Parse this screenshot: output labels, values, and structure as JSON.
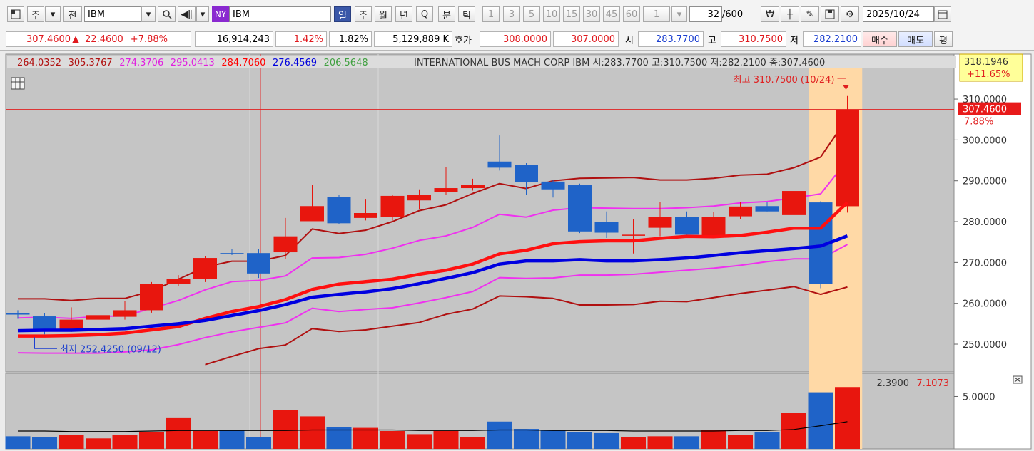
{
  "toolbar": {
    "period_week": "주",
    "prev_label": "전",
    "symbol": "IBM",
    "market_badge": "NY",
    "symbol_name": "IBM",
    "period_buttons": [
      "일",
      "주",
      "월",
      "년",
      "Q",
      "분",
      "틱"
    ],
    "minute_buttons": [
      "1",
      "3",
      "5",
      "10",
      "15",
      "30",
      "45",
      "60",
      "1"
    ],
    "count_current": "32",
    "count_max": "/600",
    "date": "2025/10/24"
  },
  "quote": {
    "price": "307.4600",
    "change_arrow": "▲",
    "change": "22.4600",
    "change_pct": "+7.88%",
    "volume": "16,914,243",
    "pct1": "1.42%",
    "pct2": "1.82%",
    "amount": "5,129,889 K",
    "hoga_label": "호가",
    "ask": "308.0000",
    "bid": "307.0000",
    "open_label": "시",
    "open": "283.7700",
    "high_label": "고",
    "high": "310.7500",
    "low_label": "저",
    "low": "282.2100",
    "buy_label": "매수",
    "sell_label": "매도",
    "eval_label": "평"
  },
  "legend": {
    "values": [
      {
        "text": "264.0352",
        "color": "#b01010"
      },
      {
        "text": "305.3767",
        "color": "#b01010"
      },
      {
        "text": "274.3706",
        "color": "#e020e0"
      },
      {
        "text": "295.0413",
        "color": "#e020e0"
      },
      {
        "text": "284.7060",
        "color": "#ff0000"
      },
      {
        "text": "276.4569",
        "color": "#0000dd"
      },
      {
        "text": "206.5648",
        "color": "#40a040"
      }
    ],
    "description": "INTERNATIONAL BUS MACH CORP  IBM 시:283.7700 고:310.7500 저:282.2100 종:307.4600"
  },
  "chart_data": {
    "type": "candlestick",
    "colors": {
      "up": "#e8160e",
      "down": "#1f63c8",
      "ma_main": "#ff1010",
      "ma_blue": "#0000e0",
      "band_outer": "#b01010",
      "band_inner": "#f030f0",
      "volume_avg": "#000000"
    },
    "candles": [
      {
        "o": 257.5,
        "h": 258.3,
        "l": 256.2,
        "c": 257.3
      },
      {
        "o": 256.8,
        "h": 257.6,
        "l": 252.4,
        "c": 253.3
      },
      {
        "o": 253.3,
        "h": 259.0,
        "l": 253.0,
        "c": 256.0
      },
      {
        "o": 256.0,
        "h": 257.3,
        "l": 255.3,
        "c": 257.1
      },
      {
        "o": 256.7,
        "h": 260.6,
        "l": 256.0,
        "c": 258.3
      },
      {
        "o": 258.3,
        "h": 265.2,
        "l": 257.7,
        "c": 264.7
      },
      {
        "o": 264.8,
        "h": 266.9,
        "l": 264.2,
        "c": 265.9
      },
      {
        "o": 265.9,
        "h": 271.5,
        "l": 265.2,
        "c": 271.1
      },
      {
        "o": 272.3,
        "h": 273.3,
        "l": 271.8,
        "c": 272.0
      },
      {
        "o": 272.3,
        "h": 273.3,
        "l": 266.2,
        "c": 267.3
      },
      {
        "o": 272.5,
        "h": 280.9,
        "l": 270.9,
        "c": 276.4
      },
      {
        "o": 280.1,
        "h": 288.9,
        "l": 280.3,
        "c": 283.8
      },
      {
        "o": 286.1,
        "h": 286.6,
        "l": 279.3,
        "c": 279.6
      },
      {
        "o": 280.9,
        "h": 285.4,
        "l": 280.3,
        "c": 282.1
      },
      {
        "o": 281.2,
        "h": 286.6,
        "l": 280.3,
        "c": 286.3
      },
      {
        "o": 285.2,
        "h": 287.9,
        "l": 283.1,
        "c": 286.6
      },
      {
        "o": 287.2,
        "h": 293.3,
        "l": 286.6,
        "c": 288.2
      },
      {
        "o": 288.2,
        "h": 290.5,
        "l": 287.6,
        "c": 288.9
      },
      {
        "o": 294.7,
        "h": 301.1,
        "l": 292.5,
        "c": 293.2
      },
      {
        "o": 293.8,
        "h": 294.3,
        "l": 286.6,
        "c": 289.6
      },
      {
        "o": 289.8,
        "h": 290.2,
        "l": 285.9,
        "c": 287.9
      },
      {
        "o": 288.9,
        "h": 289.3,
        "l": 277.2,
        "c": 277.6
      },
      {
        "o": 279.9,
        "h": 282.5,
        "l": 276.0,
        "c": 277.3
      },
      {
        "o": 276.8,
        "h": 280.6,
        "l": 272.2,
        "c": 276.8
      },
      {
        "o": 278.5,
        "h": 284.8,
        "l": 276.4,
        "c": 281.2
      },
      {
        "o": 281.1,
        "h": 282.5,
        "l": 276.8,
        "c": 276.8
      },
      {
        "o": 276.4,
        "h": 282.4,
        "l": 276.4,
        "c": 281.1
      },
      {
        "o": 281.3,
        "h": 284.9,
        "l": 280.6,
        "c": 283.7
      },
      {
        "o": 283.8,
        "h": 284.8,
        "l": 282.5,
        "c": 282.5
      },
      {
        "o": 281.6,
        "h": 289.0,
        "l": 280.4,
        "c": 287.5
      },
      {
        "o": 284.7,
        "h": 285.0,
        "l": 263.7,
        "c": 264.7
      },
      {
        "o": 283.77,
        "h": 310.75,
        "l": 282.21,
        "c": 307.46
      }
    ],
    "ma_main": [
      252.0,
      252.0,
      252.1,
      252.3,
      252.7,
      253.5,
      254.3,
      256.3,
      258.0,
      259.2,
      260.9,
      263.4,
      264.7,
      265.3,
      265.9,
      267.1,
      268.1,
      269.6,
      272.1,
      273.0,
      274.6,
      275.1,
      275.3,
      275.3,
      275.9,
      276.4,
      276.3,
      276.6,
      277.4,
      278.4,
      278.4,
      284.7
    ],
    "ma_blue": [
      253.3,
      253.4,
      253.4,
      253.6,
      253.8,
      254.4,
      255.0,
      255.8,
      257.0,
      258.2,
      259.7,
      261.5,
      262.2,
      262.8,
      263.6,
      264.8,
      266.1,
      267.5,
      269.6,
      270.4,
      270.4,
      270.7,
      270.4,
      270.4,
      270.7,
      271.1,
      271.7,
      272.4,
      272.9,
      273.4,
      274.0,
      276.5
    ],
    "band_outer_upper": [
      261.1,
      261.1,
      260.7,
      261.2,
      261.2,
      263.0,
      265.9,
      268.9,
      270.3,
      270.3,
      271.7,
      278.2,
      277.1,
      277.9,
      280.0,
      282.7,
      284.1,
      286.9,
      289.3,
      288.1,
      290.0,
      290.6,
      290.7,
      290.8,
      290.2,
      290.2,
      290.6,
      291.4,
      291.6,
      293.2,
      295.8,
      305.4
    ],
    "band_inner_upper": [
      256.4,
      256.6,
      256.3,
      256.8,
      256.9,
      258.8,
      260.7,
      263.3,
      265.3,
      265.6,
      266.7,
      271.1,
      271.2,
      272.0,
      273.5,
      275.4,
      276.5,
      278.6,
      281.8,
      281.1,
      282.8,
      283.4,
      283.3,
      283.2,
      283.2,
      283.4,
      283.8,
      284.6,
      284.9,
      285.8,
      286.8,
      295.0
    ],
    "band_inner_lower": [
      247.9,
      247.8,
      247.8,
      247.8,
      248.1,
      248.6,
      249.9,
      251.6,
      253.0,
      254.1,
      255.2,
      258.8,
      258.0,
      258.5,
      258.9,
      260.1,
      261.4,
      262.9,
      266.3,
      266.1,
      266.2,
      266.9,
      266.9,
      267.1,
      267.6,
      268.1,
      268.6,
      269.3,
      270.2,
      270.9,
      270.9,
      274.4
    ],
    "band_outer_lower": [
      null,
      null,
      null,
      null,
      null,
      null,
      null,
      245.0,
      247.0,
      248.9,
      249.8,
      253.8,
      253.1,
      253.5,
      254.4,
      255.3,
      257.3,
      258.6,
      261.8,
      261.6,
      261.2,
      259.6,
      259.6,
      259.7,
      260.5,
      260.4,
      261.4,
      262.4,
      263.2,
      264.1,
      262.2,
      264.0
    ],
    "volumes": [
      1.2,
      1.1,
      1.3,
      1.0,
      1.3,
      1.6,
      3.0,
      1.7,
      1.8,
      1.1,
      3.7,
      3.1,
      2.1,
      2.0,
      1.7,
      1.4,
      1.7,
      1.1,
      2.6,
      1.9,
      1.8,
      1.6,
      1.5,
      1.1,
      1.2,
      1.2,
      1.8,
      1.3,
      1.6,
      3.4,
      5.4,
      5.9
    ],
    "volume_avg": [
      1.7,
      1.7,
      1.65,
      1.65,
      1.65,
      1.7,
      1.75,
      1.75,
      1.75,
      1.75,
      1.75,
      1.8,
      1.8,
      1.8,
      1.8,
      1.75,
      1.75,
      1.75,
      1.8,
      1.8,
      1.75,
      1.75,
      1.75,
      1.7,
      1.7,
      1.7,
      1.7,
      1.75,
      1.75,
      1.85,
      2.2,
      2.6
    ],
    "price_axis": {
      "ylim": [
        243.2,
        321.0
      ],
      "ticks": [
        "310.0000",
        "300.0000",
        "290.0000",
        "280.0000",
        "270.0000",
        "260.0000",
        "250.0000"
      ],
      "tick_values": [
        310,
        300,
        290,
        280,
        270,
        260,
        250
      ]
    },
    "volume_axis": {
      "ylim": [
        0,
        6.8
      ],
      "ticks": [
        "5.0000"
      ],
      "tick_values": [
        5
      ]
    },
    "volume_header": {
      "v1": "2.3900",
      "v2": "7.1073"
    },
    "annotations": {
      "high_label": "최고 310.7500 (10/24)",
      "low_label": "최저 252.4250 (09/12)",
      "current_price": "307.4600",
      "current_pct": "7.88%",
      "top_box_price": "318.1946",
      "top_box_pct": "+11.65%"
    },
    "highlight_index": 31,
    "crosshair_index": 9
  }
}
